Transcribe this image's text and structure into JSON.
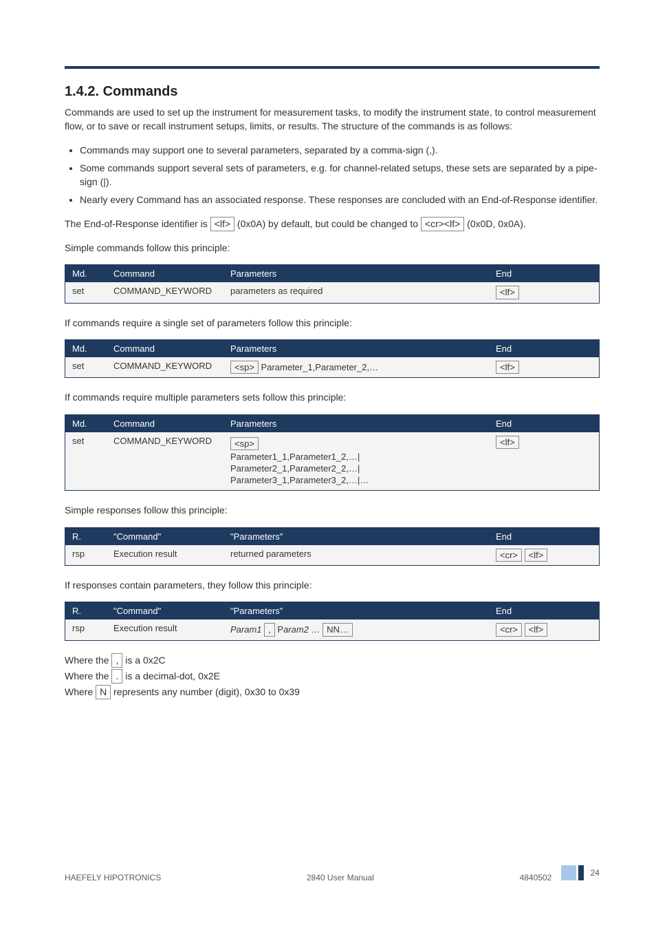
{
  "section": {
    "heading": "1.4.2. Commands",
    "p1": "Commands are used to set up the instrument for measurement tasks, to modify the instrument state, to control measurement flow, or to save or recall instrument setups, limits, or results. The structure of the commands is as follows:",
    "bullets": [
      "Commands may support one to several parameters, separated by a comma-sign (,).",
      "Some commands support several sets of parameters, e.g. for channel-related setups, these sets are separated by a pipe-sign (|).",
      "Nearly every Command has an associated response. These responses are concluded with an End-of-Response identifier."
    ],
    "p2_pre": "The End-of-Response identifier is ",
    "p2_box": "<lf>",
    "p2_post": " (0x0A) by default, but could be changed to ",
    "p2_box2": "<cr><lf>",
    "p2_post2": " (0x0D, 0x0A)."
  },
  "tables": {
    "simple": {
      "caption_intro": "Simple commands follow this principle:",
      "headers": [
        "Md.",
        "Command",
        "Parameters",
        "End"
      ],
      "row": {
        "mode": "set",
        "cmd": "COMMAND_KEYWORD",
        "params": "parameters as required",
        "end": "<lf>"
      }
    },
    "single": {
      "caption_intro": "If commands require a single set of parameters follow this principle:",
      "headers": [
        "Md.",
        "Command",
        "Parameters",
        "End"
      ],
      "row": {
        "mode": "set",
        "cmd": "COMMAND_KEYWORD",
        "params_box": "<sp>",
        "params_text": "Parameter_1,Parameter_2,…",
        "end": "<lf>"
      }
    },
    "multi": {
      "caption_intro": "If commands require multiple parameters sets follow this principle:",
      "headers": [
        "Md.",
        "Command",
        "Parameters",
        "End"
      ],
      "row": {
        "mode": "set",
        "cmd": "COMMAND_KEYWORD",
        "pre_box": "<sp>",
        "lines": [
          "Parameter1_1,Parameter1_2,…|",
          "Parameter2_1,Parameter2_2,…|",
          "Parameter3_1,Parameter3_2,…|…"
        ],
        "end": "<lf>"
      }
    },
    "resp_simple": {
      "caption_intro": "Simple responses follow this principle:",
      "headers": [
        "R.",
        "\"Command\"",
        "\"Parameters\"",
        "End"
      ],
      "row": {
        "mode": "rsp",
        "cmd": "Execution result",
        "params": "returned parameters",
        "end1": "<cr>",
        "end2": "<lf>"
      }
    },
    "resp_params": {
      "caption_intro": "If responses contain parameters, they follow this principle:",
      "headers": [
        "R.",
        "\"Command\"",
        "\"Parameters\"",
        "End"
      ],
      "row": {
        "mode": "rsp",
        "cmd": "Execution result",
        "pre_text": "Param1",
        "mid_box": ",",
        "mid_text": "P",
        "italic": "aram2 …",
        "post_box": "NN…",
        "end1": "<cr>",
        "end2": "<lf>"
      }
    }
  },
  "notes": {
    "intro": "Where the ",
    "box1": ",",
    "mid": " is a 0x2C",
    "lines": [
      {
        "pre": "Where the ",
        "box": ",",
        "post": " is a 0x2C"
      },
      {
        "pre": "Where the ",
        "box": ".",
        "post": " is a decimal-dot, 0x2E"
      },
      {
        "pre": "Where ",
        "box": "N",
        "post": " represents any number (digit), 0x30 to 0x39"
      }
    ]
  },
  "footer": {
    "left": "HAEFELY HIPOTRONICS",
    "center": "2840 User Manual",
    "right": "4840502",
    "page": "24"
  }
}
